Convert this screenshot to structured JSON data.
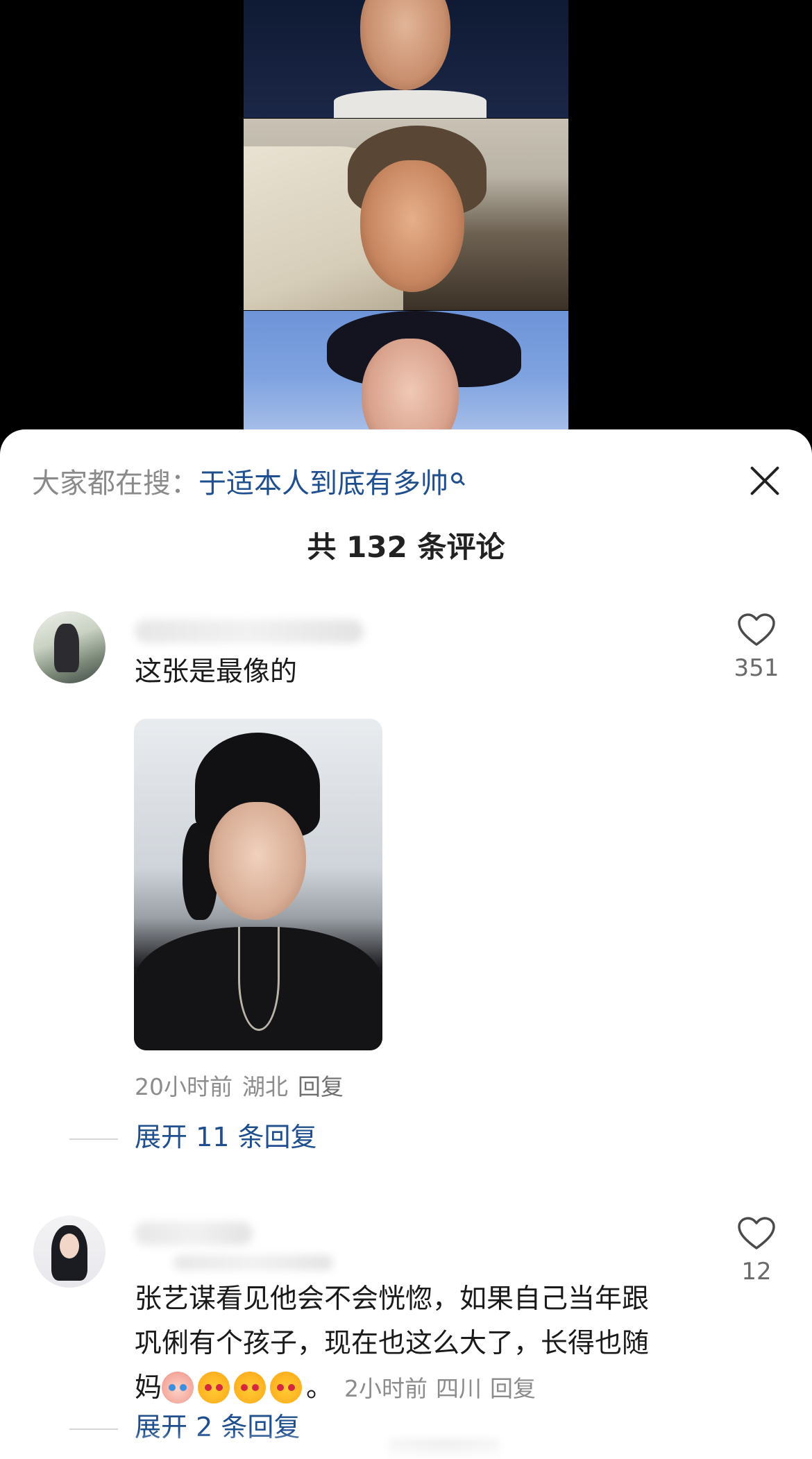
{
  "search_bar": {
    "prefix": "大家都在搜：",
    "query": "于适本人到底有多帅",
    "icon": "search-icon"
  },
  "header": {
    "comment_count_label": "共 132 条评论",
    "close_icon": "close-icon"
  },
  "comments": [
    {
      "text": "这张是最像的",
      "likes": "351",
      "time": "20小时前",
      "location": "湖北",
      "reply_label": "回复",
      "expand_label": "展开 11 条回复"
    },
    {
      "text_line1": "张艺谋看见他会不会恍惚，如果自己当年跟",
      "text_line2": "巩俐有个孩子，现在也这么大了，长得也随",
      "text_line3": "妈",
      "text_end": "。",
      "likes": "12",
      "time": "2小时前",
      "location": "四川",
      "reply_label": "回复",
      "expand_label": "展开 2 条回复"
    }
  ],
  "colors": {
    "link": "#1f4f8f",
    "muted": "#8c8c8c",
    "text": "#1a1a1a"
  }
}
